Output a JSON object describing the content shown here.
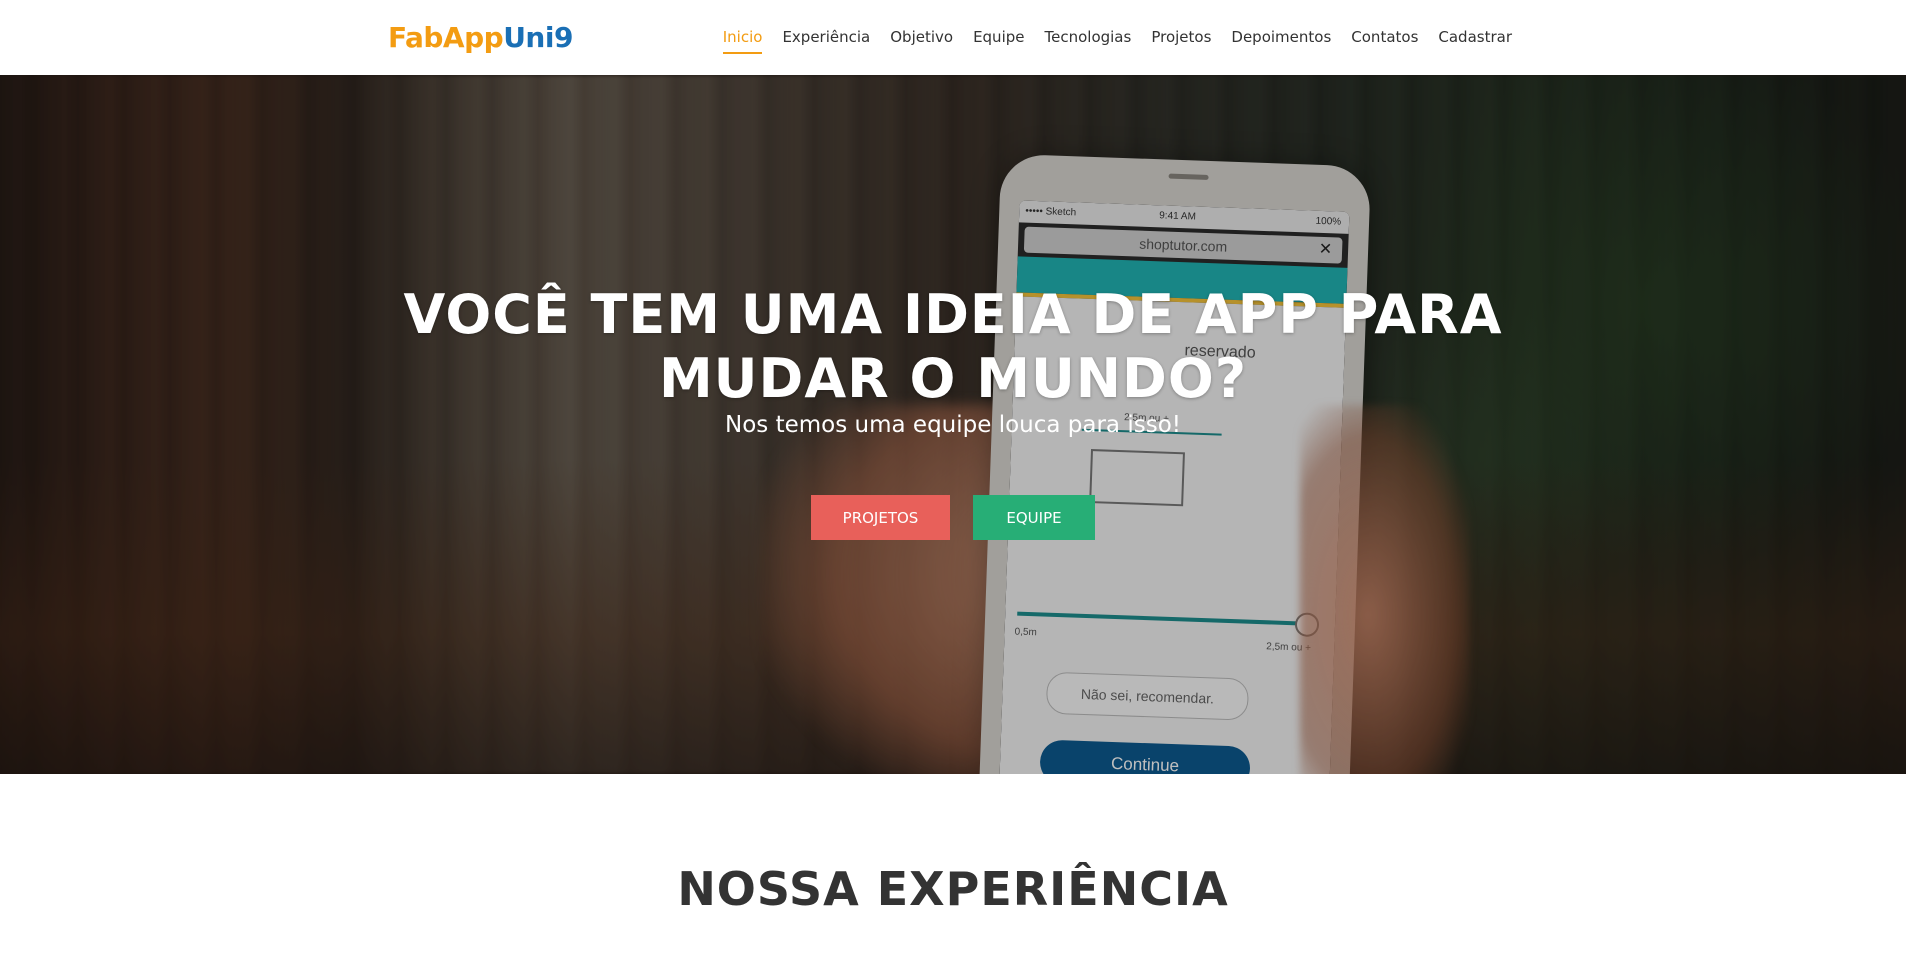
{
  "header": {
    "logo_part1": "FabApp",
    "logo_part2": "Uni9",
    "nav": [
      {
        "label": "Inicio",
        "active": true
      },
      {
        "label": "Experiência"
      },
      {
        "label": "Objetivo"
      },
      {
        "label": "Equipe"
      },
      {
        "label": "Tecnologias"
      },
      {
        "label": "Projetos"
      },
      {
        "label": "Depoimentos"
      },
      {
        "label": "Contatos"
      },
      {
        "label": "Cadastrar"
      }
    ]
  },
  "hero": {
    "title": "VOCÊ TEM UMA IDEIA DE APP PARA MUDAR O MUNDO?",
    "subtitle": "Nos temos uma equipe louca para isso!",
    "button_projetos": "PROJETOS",
    "button_equipe": "EQUIPE",
    "phone": {
      "carrier": "••••• Sketch",
      "time": "9:41 AM",
      "battery": "100%",
      "url": "shoptutor.com",
      "close": "✕",
      "heading": "reservado",
      "range_min": "0,5m",
      "range_max": "2,5m ou +",
      "range_top": "2,5m ou +",
      "secondary": "Não sei, recomendar.",
      "cta": "Continue"
    }
  },
  "section": {
    "title": "NOSSA EXPERIÊNCIA"
  },
  "colors": {
    "accent": "#f39c12",
    "logo_blue": "#1a6fb5",
    "btn_projetos": "#e8605a",
    "btn_equipe": "#27ae76",
    "text_dark": "#333333"
  }
}
